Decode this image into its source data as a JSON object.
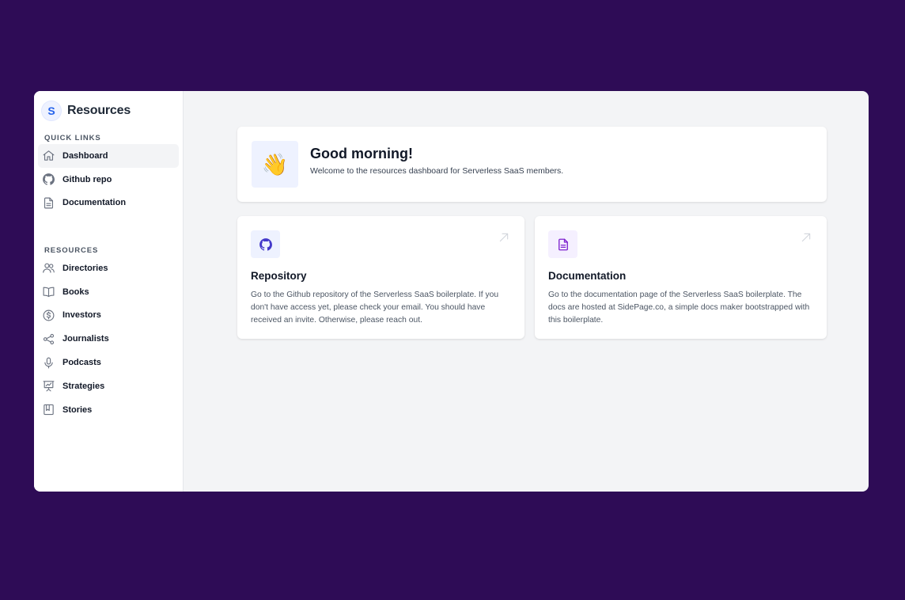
{
  "sidebar": {
    "brand": {
      "logo_letter": "S",
      "title": "Resources"
    },
    "quick_links_label": "Quick links",
    "quick_links": [
      {
        "label": "Dashboard",
        "icon": "home-icon",
        "active": true
      },
      {
        "label": "Github repo",
        "icon": "github-icon",
        "active": false
      },
      {
        "label": "Documentation",
        "icon": "document-icon",
        "active": false
      }
    ],
    "resources_label": "Resources",
    "resources": [
      {
        "label": "Directories",
        "icon": "users-icon"
      },
      {
        "label": "Books",
        "icon": "book-icon"
      },
      {
        "label": "Investors",
        "icon": "dollar-icon"
      },
      {
        "label": "Journalists",
        "icon": "share-icon"
      },
      {
        "label": "Podcasts",
        "icon": "microphone-icon"
      },
      {
        "label": "Strategies",
        "icon": "presentation-chart-icon"
      },
      {
        "label": "Stories",
        "icon": "bookmark-book-icon"
      }
    ]
  },
  "greeting": {
    "emoji": "👋",
    "title": "Good morning!",
    "subtitle": "Welcome to the resources dashboard for Serverless SaaS members."
  },
  "cards": {
    "repository": {
      "icon": "github-icon",
      "title": "Repository",
      "description": "Go to the Github repository of the Serverless SaaS boilerplate. If you don't have access yet, please check your email. You should have received an invite. Otherwise, please reach out."
    },
    "documentation": {
      "icon": "document-icon",
      "title": "Documentation",
      "description": "Go to the documentation page of the Serverless SaaS boilerplate. The docs are hosted at SidePage.co, a simple docs maker bootstrapped with this boilerplate."
    }
  },
  "colors": {
    "background": "#2e0c56",
    "brand_accent": "#2563eb",
    "repo_icon": "#4338ca",
    "docs_icon": "#7e22ce"
  }
}
